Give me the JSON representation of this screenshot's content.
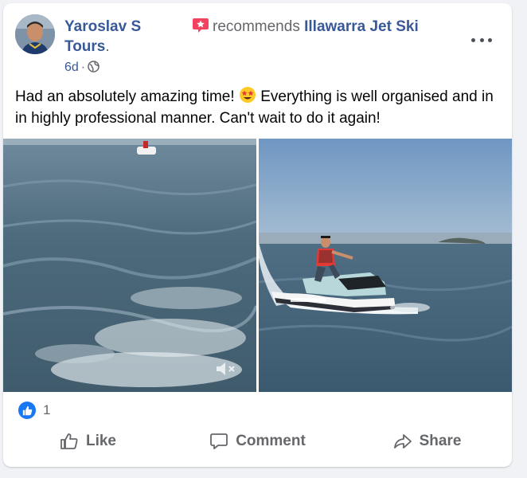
{
  "post": {
    "author_line1": "Yaroslav S",
    "author_line2": "Tours",
    "author_dot": ".",
    "recommends_text": "recommends",
    "page_name": "Illawarra Jet Ski",
    "time_ago": "6d",
    "separator": "·",
    "body_part1": "Had an absolutely amazing time!",
    "body_part2": "Everything is well organised and in in highly professional manner. Can't wait to do it again!",
    "reaction_count": "1"
  },
  "actions": {
    "like": "Like",
    "comment": "Comment",
    "share": "Share"
  },
  "icons": {
    "recommend": "recommend-star-icon",
    "privacy": "globe-icon",
    "more": "more-options-icon",
    "emoji": "star-struck-emoji",
    "mute": "muted-speaker-icon",
    "reaction": "thumbs-up-icon"
  },
  "colors": {
    "link_blue": "#385898",
    "secondary_text": "#65676b",
    "like_blue": "#1877f2",
    "recommend_red": "#f3425f"
  }
}
